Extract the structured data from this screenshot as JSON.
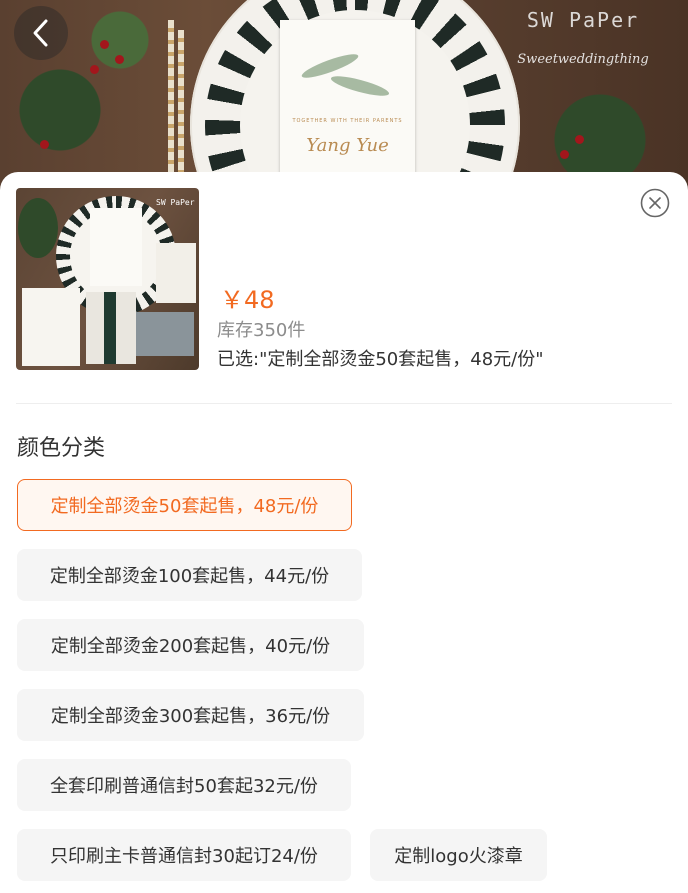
{
  "header": {
    "back_icon": "chevron-left-icon",
    "brand_name": "SW PaPer",
    "brand_sub": "Sweetweddingthing",
    "photo_card_script": "Yang Yue",
    "photo_card_small": "TOGETHER WITH THEIR PARENTS"
  },
  "sheet": {
    "close_icon": "close-circle-icon",
    "thumbnail_brand": "SW PaPer",
    "price": "￥48",
    "stock": "库存350件",
    "selected": "已选:\"定制全部烫金50套起售，48元/份\"",
    "accent_color": "#f26a21"
  },
  "variants": {
    "title": "颜色分类",
    "options": [
      {
        "label": "定制全部烫金50套起售，48元/份",
        "selected": true
      },
      {
        "label": "定制全部烫金100套起售，44元/份",
        "selected": false
      },
      {
        "label": "定制全部烫金200套起售，40元/份",
        "selected": false
      },
      {
        "label": "定制全部烫金300套起售，36元/份",
        "selected": false
      },
      {
        "label": "全套印刷普通信封50套起32元/份",
        "selected": false
      },
      {
        "label": "只印刷主卡普通信封30起订24/份",
        "selected": false
      },
      {
        "label": "定制logo火漆章",
        "selected": false
      }
    ]
  }
}
